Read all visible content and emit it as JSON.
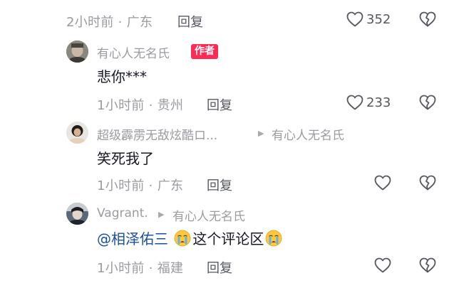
{
  "comments": [
    {
      "meta": "2小时前 · 广东",
      "reply_label": "回复",
      "likes": "352"
    },
    {
      "username": "有心人无名氏",
      "badge": "作者",
      "text": "悲你***",
      "meta": "1小时前 · 贵州",
      "reply_label": "回复",
      "likes": "233"
    },
    {
      "username": "超级霹雳无敌炫酷ロ...",
      "reply_to": "有心人无名氏",
      "text": "笑死我了",
      "meta": "1小时前 · 广东",
      "reply_label": "回复"
    },
    {
      "username": "Vagrant.",
      "reply_to": "有心人无名氏",
      "mention": "@相泽佑三",
      "text_after": "这个评论区",
      "meta": "1小时前 · 福建",
      "reply_label": "回复"
    }
  ],
  "icons": {
    "like": "heart-outline-icon",
    "dislike": "broken-heart-icon",
    "emoji": "crying-face-emoji",
    "reply_arrow": "triangle-right-icon"
  },
  "colors": {
    "badge": "#fe2c55",
    "mention": "#1a4fa6",
    "meta": "#9b9ba1",
    "text": "#161823"
  }
}
